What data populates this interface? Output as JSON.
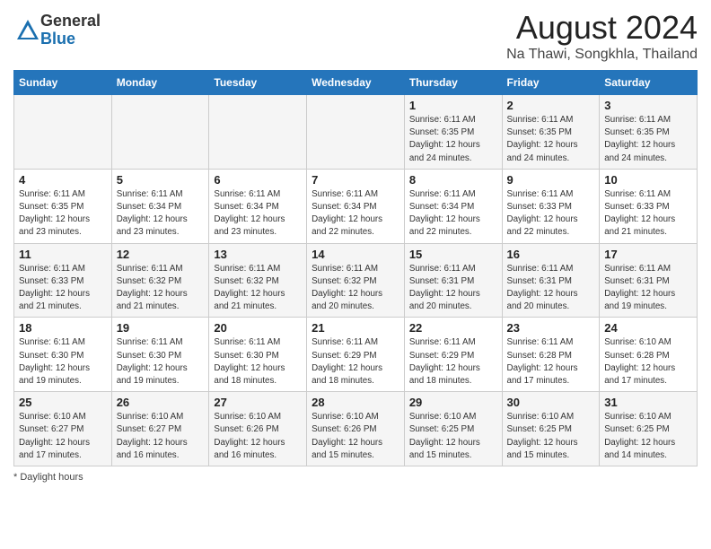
{
  "header": {
    "logo_general": "General",
    "logo_blue": "Blue",
    "month_year": "August 2024",
    "location": "Na Thawi, Songkhla, Thailand"
  },
  "weekdays": [
    "Sunday",
    "Monday",
    "Tuesday",
    "Wednesday",
    "Thursday",
    "Friday",
    "Saturday"
  ],
  "weeks": [
    [
      {
        "day": "",
        "info": ""
      },
      {
        "day": "",
        "info": ""
      },
      {
        "day": "",
        "info": ""
      },
      {
        "day": "",
        "info": ""
      },
      {
        "day": "1",
        "info": "Sunrise: 6:11 AM\nSunset: 6:35 PM\nDaylight: 12 hours and 24 minutes."
      },
      {
        "day": "2",
        "info": "Sunrise: 6:11 AM\nSunset: 6:35 PM\nDaylight: 12 hours and 24 minutes."
      },
      {
        "day": "3",
        "info": "Sunrise: 6:11 AM\nSunset: 6:35 PM\nDaylight: 12 hours and 24 minutes."
      }
    ],
    [
      {
        "day": "4",
        "info": "Sunrise: 6:11 AM\nSunset: 6:35 PM\nDaylight: 12 hours and 23 minutes."
      },
      {
        "day": "5",
        "info": "Sunrise: 6:11 AM\nSunset: 6:34 PM\nDaylight: 12 hours and 23 minutes."
      },
      {
        "day": "6",
        "info": "Sunrise: 6:11 AM\nSunset: 6:34 PM\nDaylight: 12 hours and 23 minutes."
      },
      {
        "day": "7",
        "info": "Sunrise: 6:11 AM\nSunset: 6:34 PM\nDaylight: 12 hours and 22 minutes."
      },
      {
        "day": "8",
        "info": "Sunrise: 6:11 AM\nSunset: 6:34 PM\nDaylight: 12 hours and 22 minutes."
      },
      {
        "day": "9",
        "info": "Sunrise: 6:11 AM\nSunset: 6:33 PM\nDaylight: 12 hours and 22 minutes."
      },
      {
        "day": "10",
        "info": "Sunrise: 6:11 AM\nSunset: 6:33 PM\nDaylight: 12 hours and 21 minutes."
      }
    ],
    [
      {
        "day": "11",
        "info": "Sunrise: 6:11 AM\nSunset: 6:33 PM\nDaylight: 12 hours and 21 minutes."
      },
      {
        "day": "12",
        "info": "Sunrise: 6:11 AM\nSunset: 6:32 PM\nDaylight: 12 hours and 21 minutes."
      },
      {
        "day": "13",
        "info": "Sunrise: 6:11 AM\nSunset: 6:32 PM\nDaylight: 12 hours and 21 minutes."
      },
      {
        "day": "14",
        "info": "Sunrise: 6:11 AM\nSunset: 6:32 PM\nDaylight: 12 hours and 20 minutes."
      },
      {
        "day": "15",
        "info": "Sunrise: 6:11 AM\nSunset: 6:31 PM\nDaylight: 12 hours and 20 minutes."
      },
      {
        "day": "16",
        "info": "Sunrise: 6:11 AM\nSunset: 6:31 PM\nDaylight: 12 hours and 20 minutes."
      },
      {
        "day": "17",
        "info": "Sunrise: 6:11 AM\nSunset: 6:31 PM\nDaylight: 12 hours and 19 minutes."
      }
    ],
    [
      {
        "day": "18",
        "info": "Sunrise: 6:11 AM\nSunset: 6:30 PM\nDaylight: 12 hours and 19 minutes."
      },
      {
        "day": "19",
        "info": "Sunrise: 6:11 AM\nSunset: 6:30 PM\nDaylight: 12 hours and 19 minutes."
      },
      {
        "day": "20",
        "info": "Sunrise: 6:11 AM\nSunset: 6:30 PM\nDaylight: 12 hours and 18 minutes."
      },
      {
        "day": "21",
        "info": "Sunrise: 6:11 AM\nSunset: 6:29 PM\nDaylight: 12 hours and 18 minutes."
      },
      {
        "day": "22",
        "info": "Sunrise: 6:11 AM\nSunset: 6:29 PM\nDaylight: 12 hours and 18 minutes."
      },
      {
        "day": "23",
        "info": "Sunrise: 6:11 AM\nSunset: 6:28 PM\nDaylight: 12 hours and 17 minutes."
      },
      {
        "day": "24",
        "info": "Sunrise: 6:10 AM\nSunset: 6:28 PM\nDaylight: 12 hours and 17 minutes."
      }
    ],
    [
      {
        "day": "25",
        "info": "Sunrise: 6:10 AM\nSunset: 6:27 PM\nDaylight: 12 hours and 17 minutes."
      },
      {
        "day": "26",
        "info": "Sunrise: 6:10 AM\nSunset: 6:27 PM\nDaylight: 12 hours and 16 minutes."
      },
      {
        "day": "27",
        "info": "Sunrise: 6:10 AM\nSunset: 6:26 PM\nDaylight: 12 hours and 16 minutes."
      },
      {
        "day": "28",
        "info": "Sunrise: 6:10 AM\nSunset: 6:26 PM\nDaylight: 12 hours and 15 minutes."
      },
      {
        "day": "29",
        "info": "Sunrise: 6:10 AM\nSunset: 6:25 PM\nDaylight: 12 hours and 15 minutes."
      },
      {
        "day": "30",
        "info": "Sunrise: 6:10 AM\nSunset: 6:25 PM\nDaylight: 12 hours and 15 minutes."
      },
      {
        "day": "31",
        "info": "Sunrise: 6:10 AM\nSunset: 6:25 PM\nDaylight: 12 hours and 14 minutes."
      }
    ]
  ],
  "footer": {
    "note": "Daylight hours"
  }
}
